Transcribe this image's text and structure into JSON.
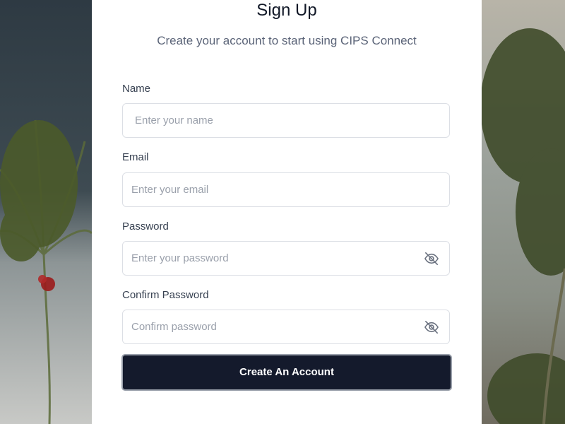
{
  "form": {
    "title": "Sign Up",
    "subtitle": "Create your account to start using CIPS Connect",
    "fields": [
      {
        "label": "Name",
        "placeholder": "Enter your name"
      },
      {
        "label": "Email",
        "placeholder": "Enter your email"
      },
      {
        "label": "Password",
        "placeholder": "Enter your password",
        "icon": "eye-off-icon"
      },
      {
        "label": "Confirm Password",
        "placeholder": "Confirm password",
        "icon": "eye-off-icon"
      }
    ],
    "submit_label": "Create An Account"
  },
  "colors": {
    "primary_button": "#141a2c",
    "text_dark": "#111827",
    "text_muted": "#5b6478",
    "placeholder": "#9aa0ab",
    "border": "#dcdfe5"
  }
}
